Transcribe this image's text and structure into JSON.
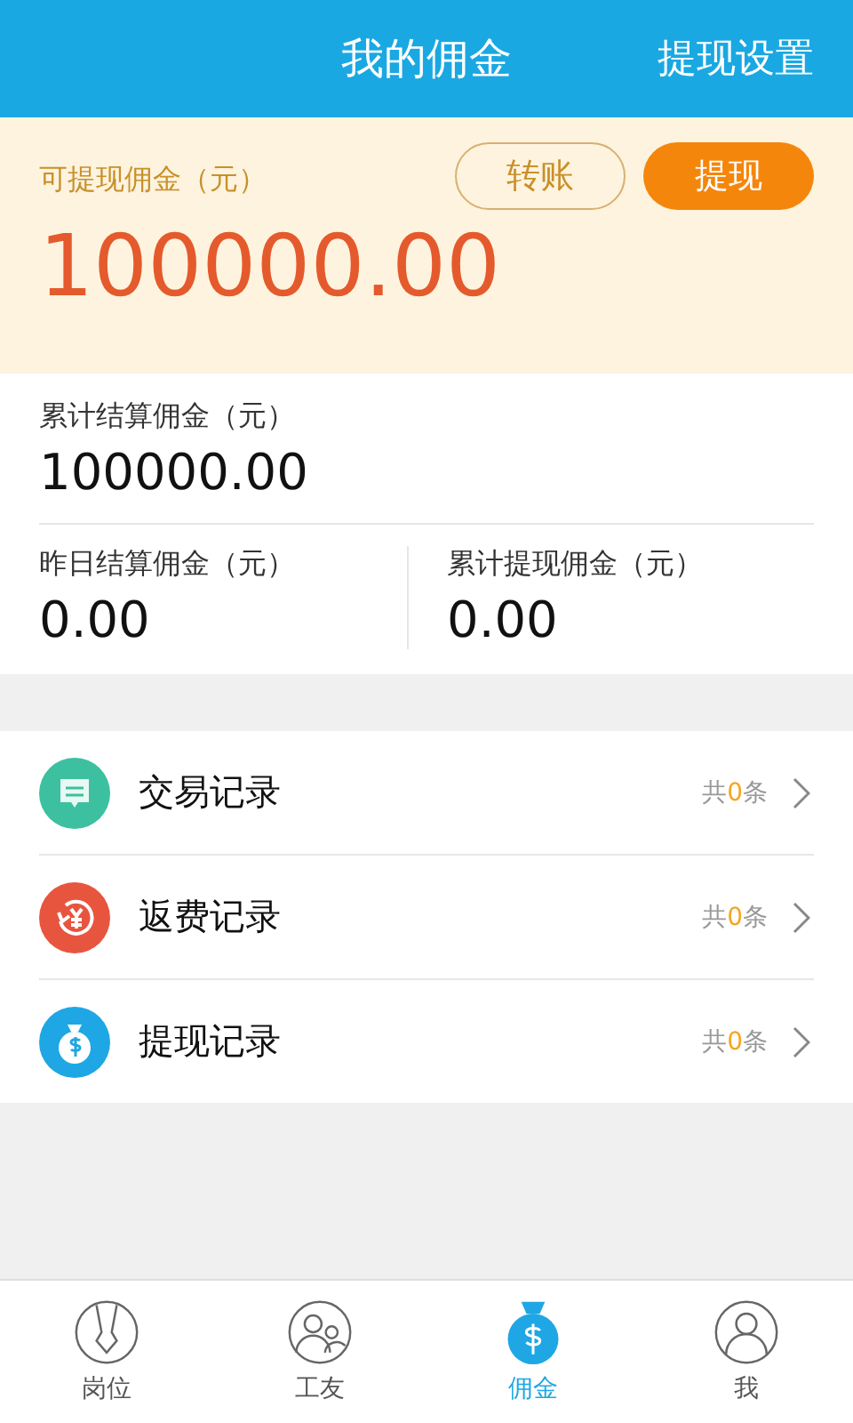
{
  "header": {
    "title": "我的佣金",
    "action": "提现设置"
  },
  "available": {
    "label": "可提现佣金（元）",
    "amount": "100000.00",
    "buttons": [
      {
        "label": "转账",
        "kind": "outline"
      },
      {
        "label": "提现",
        "kind": "filled"
      }
    ]
  },
  "total": {
    "label": "累计结算佣金（元）",
    "value": "100000.00"
  },
  "stats": [
    {
      "label": "昨日结算佣金（元）",
      "value": "0.00"
    },
    {
      "label": "累计提现佣金（元）",
      "value": "0.00"
    }
  ],
  "records": [
    {
      "kind": "chat",
      "color": "#3cc0a0",
      "label": "交易记录",
      "prefix": "共",
      "count": "0",
      "suffix": "条"
    },
    {
      "kind": "refund",
      "color": "#e8553f",
      "label": "返费记录",
      "prefix": "共",
      "count": "0",
      "suffix": "条"
    },
    {
      "kind": "moneybag",
      "color": "#1ea7e4",
      "label": "提现记录",
      "prefix": "共",
      "count": "0",
      "suffix": "条"
    }
  ],
  "tabs": [
    {
      "kind": "job",
      "label": "岗位",
      "selected": false
    },
    {
      "kind": "friends",
      "label": "工友",
      "selected": false
    },
    {
      "kind": "commission",
      "label": "佣金",
      "selected": true
    },
    {
      "kind": "me",
      "label": "我",
      "selected": false
    }
  ]
}
